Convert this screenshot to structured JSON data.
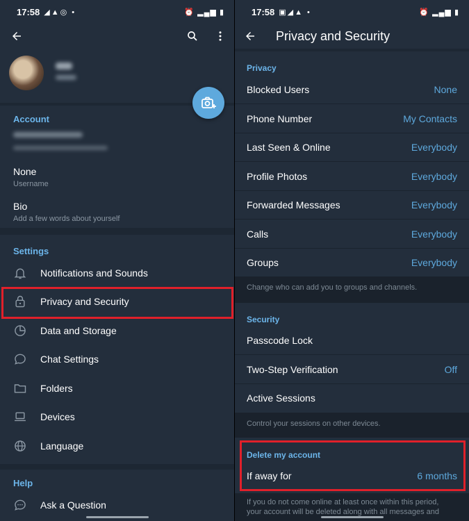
{
  "status": {
    "left_time": "17:58",
    "right_time": "17:58"
  },
  "left": {
    "account_title": "Account",
    "username_value": "None",
    "username_label": "Username",
    "bio_label": "Bio",
    "bio_hint": "Add a few words about yourself",
    "settings_title": "Settings",
    "menu": [
      {
        "label": "Notifications and Sounds",
        "icon": "bell-icon"
      },
      {
        "label": "Privacy and Security",
        "icon": "lock-icon"
      },
      {
        "label": "Data and Storage",
        "icon": "pie-chart-icon"
      },
      {
        "label": "Chat Settings",
        "icon": "chat-bubble-icon"
      },
      {
        "label": "Folders",
        "icon": "folder-icon"
      },
      {
        "label": "Devices",
        "icon": "laptop-icon"
      },
      {
        "label": "Language",
        "icon": "globe-icon"
      }
    ],
    "help_title": "Help",
    "help_items": [
      {
        "label": "Ask a Question",
        "icon": "question-chat-icon"
      }
    ]
  },
  "right": {
    "title": "Privacy and Security",
    "privacy_title": "Privacy",
    "privacy_rows": [
      {
        "label": "Blocked Users",
        "value": "None"
      },
      {
        "label": "Phone Number",
        "value": "My Contacts"
      },
      {
        "label": "Last Seen & Online",
        "value": "Everybody"
      },
      {
        "label": "Profile Photos",
        "value": "Everybody"
      },
      {
        "label": "Forwarded Messages",
        "value": "Everybody"
      },
      {
        "label": "Calls",
        "value": "Everybody"
      },
      {
        "label": "Groups",
        "value": "Everybody"
      }
    ],
    "groups_info": "Change who can add you to groups and channels.",
    "security_title": "Security",
    "security_rows": [
      {
        "label": "Passcode Lock",
        "value": ""
      },
      {
        "label": "Two-Step Verification",
        "value": "Off"
      },
      {
        "label": "Active Sessions",
        "value": ""
      }
    ],
    "sessions_info": "Control your sessions on other devices.",
    "delete_title": "Delete my account",
    "away_label": "If away for",
    "away_value": "6 months",
    "delete_info_1": "If you do not come online at least once within this period,",
    "delete_info_2": "your account will be deleted along with all messages and"
  },
  "colors": {
    "accent": "#5ea9dd",
    "highlight": "#e0202a",
    "bg": "#1d2733",
    "surface": "#232e3c"
  }
}
